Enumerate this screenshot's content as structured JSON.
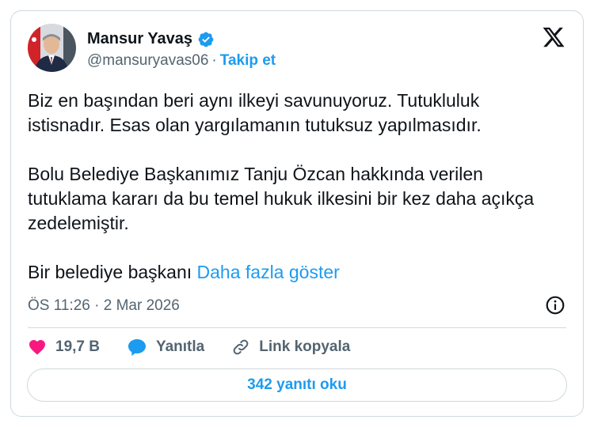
{
  "tweet": {
    "author_name": "Mansur Yavaş",
    "handle": "@mansuryavas06",
    "separator": "·",
    "follow_label": "Takip et",
    "body_main": "Biz en başından beri aynı ilkeyi savunuyoruz. Tutukluluk istisnadır. Esas olan yargılamanın tutuksuz yapılmasıdır.\n\nBolu Belediye Başkanımız Tanju Özcan hakkında verilen tutuklama kararı da bu temel hukuk ilkesini bir kez daha açıkça zedelemiştir.\n\nBir belediye başkanı ",
    "show_more_label": "Daha fazla göster",
    "timestamp": "ÖS 11:26 · 2 Mar 2026",
    "like_count": "19,7 B",
    "reply_label": "Yanıtla",
    "copy_link_label": "Link kopyala",
    "read_replies_label": "342 yanıtı oku"
  },
  "colors": {
    "accent": "#1d9bf0",
    "like": "#f91880",
    "muted": "#536471",
    "border": "#cfd9de"
  },
  "icons": {
    "verified": "verified-badge-icon",
    "x_logo": "x-logo-icon",
    "info": "info-icon",
    "heart": "heart-icon",
    "reply": "speech-bubble-icon",
    "link": "link-icon"
  }
}
